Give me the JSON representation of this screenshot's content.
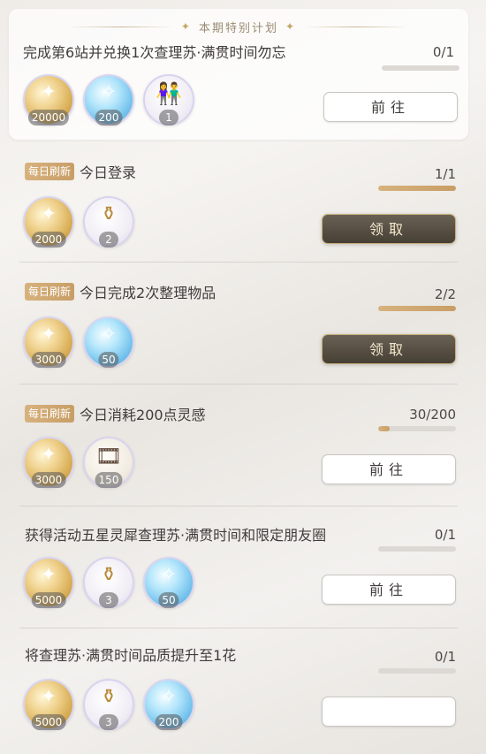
{
  "section_header": "本期特别计划",
  "tasks": [
    {
      "title": "完成第6站并兑换1次查理苏·满贯时间勿忘",
      "progress_text": "0/1",
      "progress": 0,
      "rewards": [
        {
          "icon": "gold-coin-icon",
          "qty": "20000"
        },
        {
          "icon": "blue-crystal-icon",
          "qty": "200"
        },
        {
          "icon": "avatar-frame-icon",
          "qty": "1"
        }
      ],
      "button_label": "前往"
    },
    {
      "badge": "每日刷新",
      "title": "今日登录",
      "progress_text": "1/1",
      "progress": 1,
      "rewards": [
        {
          "icon": "gold-coin-icon",
          "qty": "2000"
        },
        {
          "icon": "golden-bottle-icon",
          "qty": "2"
        }
      ],
      "button_label": "领取"
    },
    {
      "badge": "每日刷新",
      "title": "今日完成2次整理物品",
      "progress_text": "2/2",
      "progress": 1,
      "rewards": [
        {
          "icon": "gold-coin-icon",
          "qty": "3000"
        },
        {
          "icon": "blue-crystal-icon",
          "qty": "50"
        }
      ],
      "button_label": "领取"
    },
    {
      "badge": "每日刷新",
      "title": "今日消耗200点灵感",
      "progress_text": "30/200",
      "progress": 0.15,
      "rewards": [
        {
          "icon": "gold-coin-icon",
          "qty": "3000"
        },
        {
          "icon": "film-item-icon",
          "qty": "150"
        }
      ],
      "button_label": "前往"
    },
    {
      "title": "获得活动五星灵犀查理苏·满贯时间和限定朋友圈",
      "progress_text": "0/1",
      "progress": 0,
      "rewards": [
        {
          "icon": "gold-coin-icon",
          "qty": "5000"
        },
        {
          "icon": "golden-bottle-icon",
          "qty": "3"
        },
        {
          "icon": "blue-crystal-icon",
          "qty": "50"
        }
      ],
      "button_label": "前往"
    },
    {
      "title": "将查理苏·满贯时间品质提升至1花",
      "progress_text": "0/1",
      "progress": 0,
      "rewards": [
        {
          "icon": "gold-coin-icon",
          "qty": "5000"
        },
        {
          "icon": "golden-bottle-icon",
          "qty": "3"
        },
        {
          "icon": "blue-crystal-icon",
          "qty": "200"
        }
      ],
      "button_label": ""
    }
  ]
}
